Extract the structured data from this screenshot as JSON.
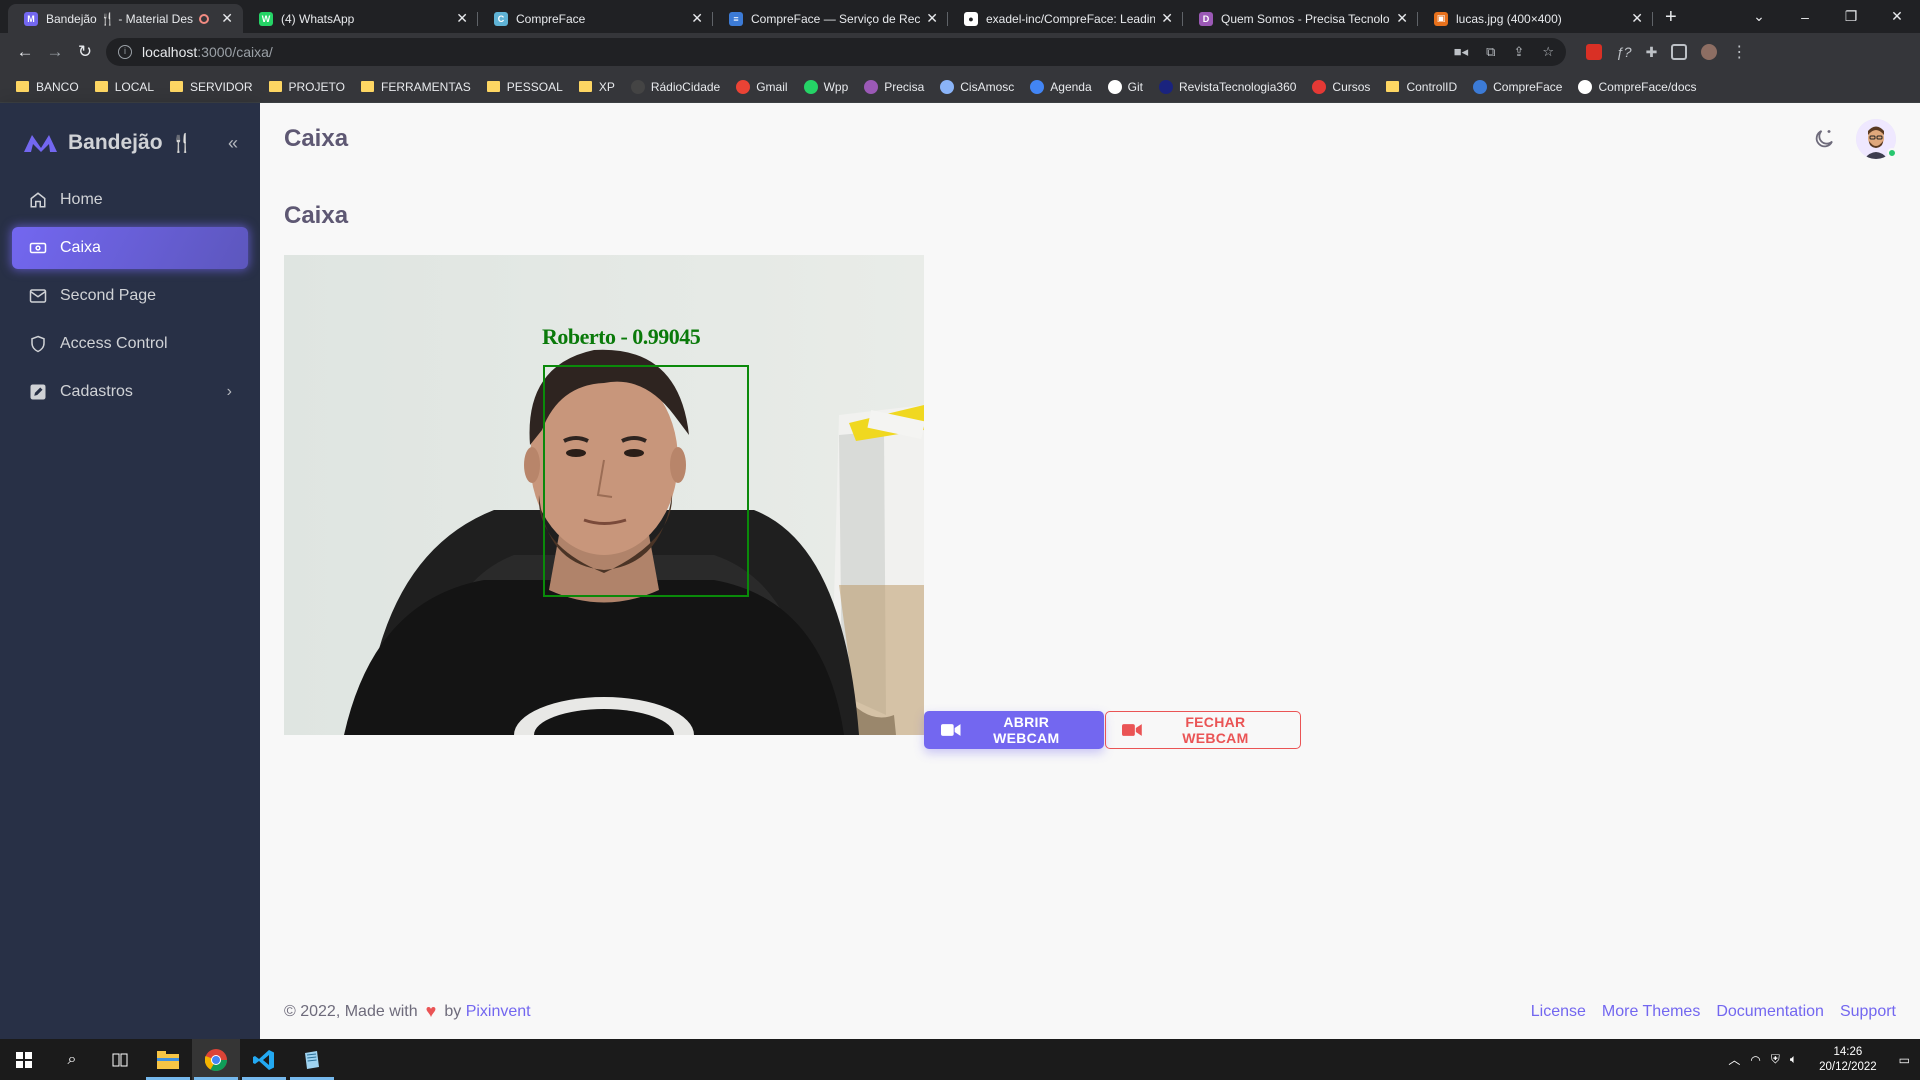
{
  "browser": {
    "tabs": [
      {
        "title": "Bandejão 🍴 - Material Desig",
        "favicon_color": "#7367f0",
        "favicon_glyph": "M",
        "active": true,
        "recording": true
      },
      {
        "title": "(4) WhatsApp",
        "favicon_color": "#25d366",
        "favicon_glyph": "W"
      },
      {
        "title": "CompreFace",
        "favicon_color": "#5fb3d6",
        "favicon_glyph": "C"
      },
      {
        "title": "CompreFace — Serviço de Reco",
        "favicon_color": "#3c7bd6",
        "favicon_glyph": "≡"
      },
      {
        "title": "exadel-inc/CompreFace: Leadin",
        "favicon_color": "#ffffff",
        "favicon_glyph": "●"
      },
      {
        "title": "Quem Somos - Precisa Tecnolog",
        "favicon_color": "#9b59b6",
        "favicon_glyph": "D"
      },
      {
        "title": "lucas.jpg (400×400)",
        "favicon_color": "#e8711c",
        "favicon_glyph": "▣"
      }
    ],
    "url_host": "localhost",
    "url_path": ":3000/caixa/",
    "bookmarks": [
      {
        "label": "BANCO",
        "type": "folder"
      },
      {
        "label": "LOCAL",
        "type": "folder"
      },
      {
        "label": "SERVIDOR",
        "type": "folder"
      },
      {
        "label": "PROJETO",
        "type": "folder"
      },
      {
        "label": "FERRAMENTAS",
        "type": "folder"
      },
      {
        "label": "PESSOAL",
        "type": "folder"
      },
      {
        "label": "XP",
        "type": "folder"
      },
      {
        "label": "RádioCidade",
        "type": "link",
        "color": "#444"
      },
      {
        "label": "Gmail",
        "type": "link",
        "color": "#ea4335"
      },
      {
        "label": "Wpp",
        "type": "link",
        "color": "#25d366"
      },
      {
        "label": "Precisa",
        "type": "link",
        "color": "#9b59b6"
      },
      {
        "label": "CisAmosc",
        "type": "link",
        "color": "#8ab4f8"
      },
      {
        "label": "Agenda",
        "type": "link",
        "color": "#4285f4"
      },
      {
        "label": "Git",
        "type": "link",
        "color": "#ffffff"
      },
      {
        "label": "RevistaTecnologia360",
        "type": "link",
        "color": "#1a237e"
      },
      {
        "label": "Cursos",
        "type": "link",
        "color": "#e53935"
      },
      {
        "label": "ControlID",
        "type": "folder"
      },
      {
        "label": "CompreFace",
        "type": "link",
        "color": "#3c7bd6"
      },
      {
        "label": "CompreFace/docs",
        "type": "link",
        "color": "#ffffff"
      }
    ]
  },
  "sidebar": {
    "brand": "Bandejão",
    "brand_suffix": "🍴",
    "items": [
      {
        "label": "Home",
        "icon": "home-icon"
      },
      {
        "label": "Caixa",
        "icon": "cash-icon",
        "active": true
      },
      {
        "label": "Second Page",
        "icon": "mail-icon"
      },
      {
        "label": "Access Control",
        "icon": "shield-icon"
      },
      {
        "label": "Cadastros",
        "icon": "edit-icon",
        "has_children": true
      }
    ]
  },
  "header": {
    "title": "Caixa"
  },
  "main": {
    "heading": "Caixa",
    "detection_label": "Roberto - 0.99045",
    "open_button": "ABRIR WEBCAM",
    "close_button": "FECHAR WEBCAM"
  },
  "footer": {
    "copyright": "© 2022, Made with",
    "by": "by",
    "author": "Pixinvent",
    "links": [
      "License",
      "More Themes",
      "Documentation",
      "Support"
    ]
  },
  "taskbar": {
    "time": "14:26",
    "date": "20/12/2022"
  },
  "colors": {
    "primary": "#7367f0",
    "danger": "#ea5455",
    "sidebar_bg": "#283046",
    "success": "#28c76f"
  }
}
